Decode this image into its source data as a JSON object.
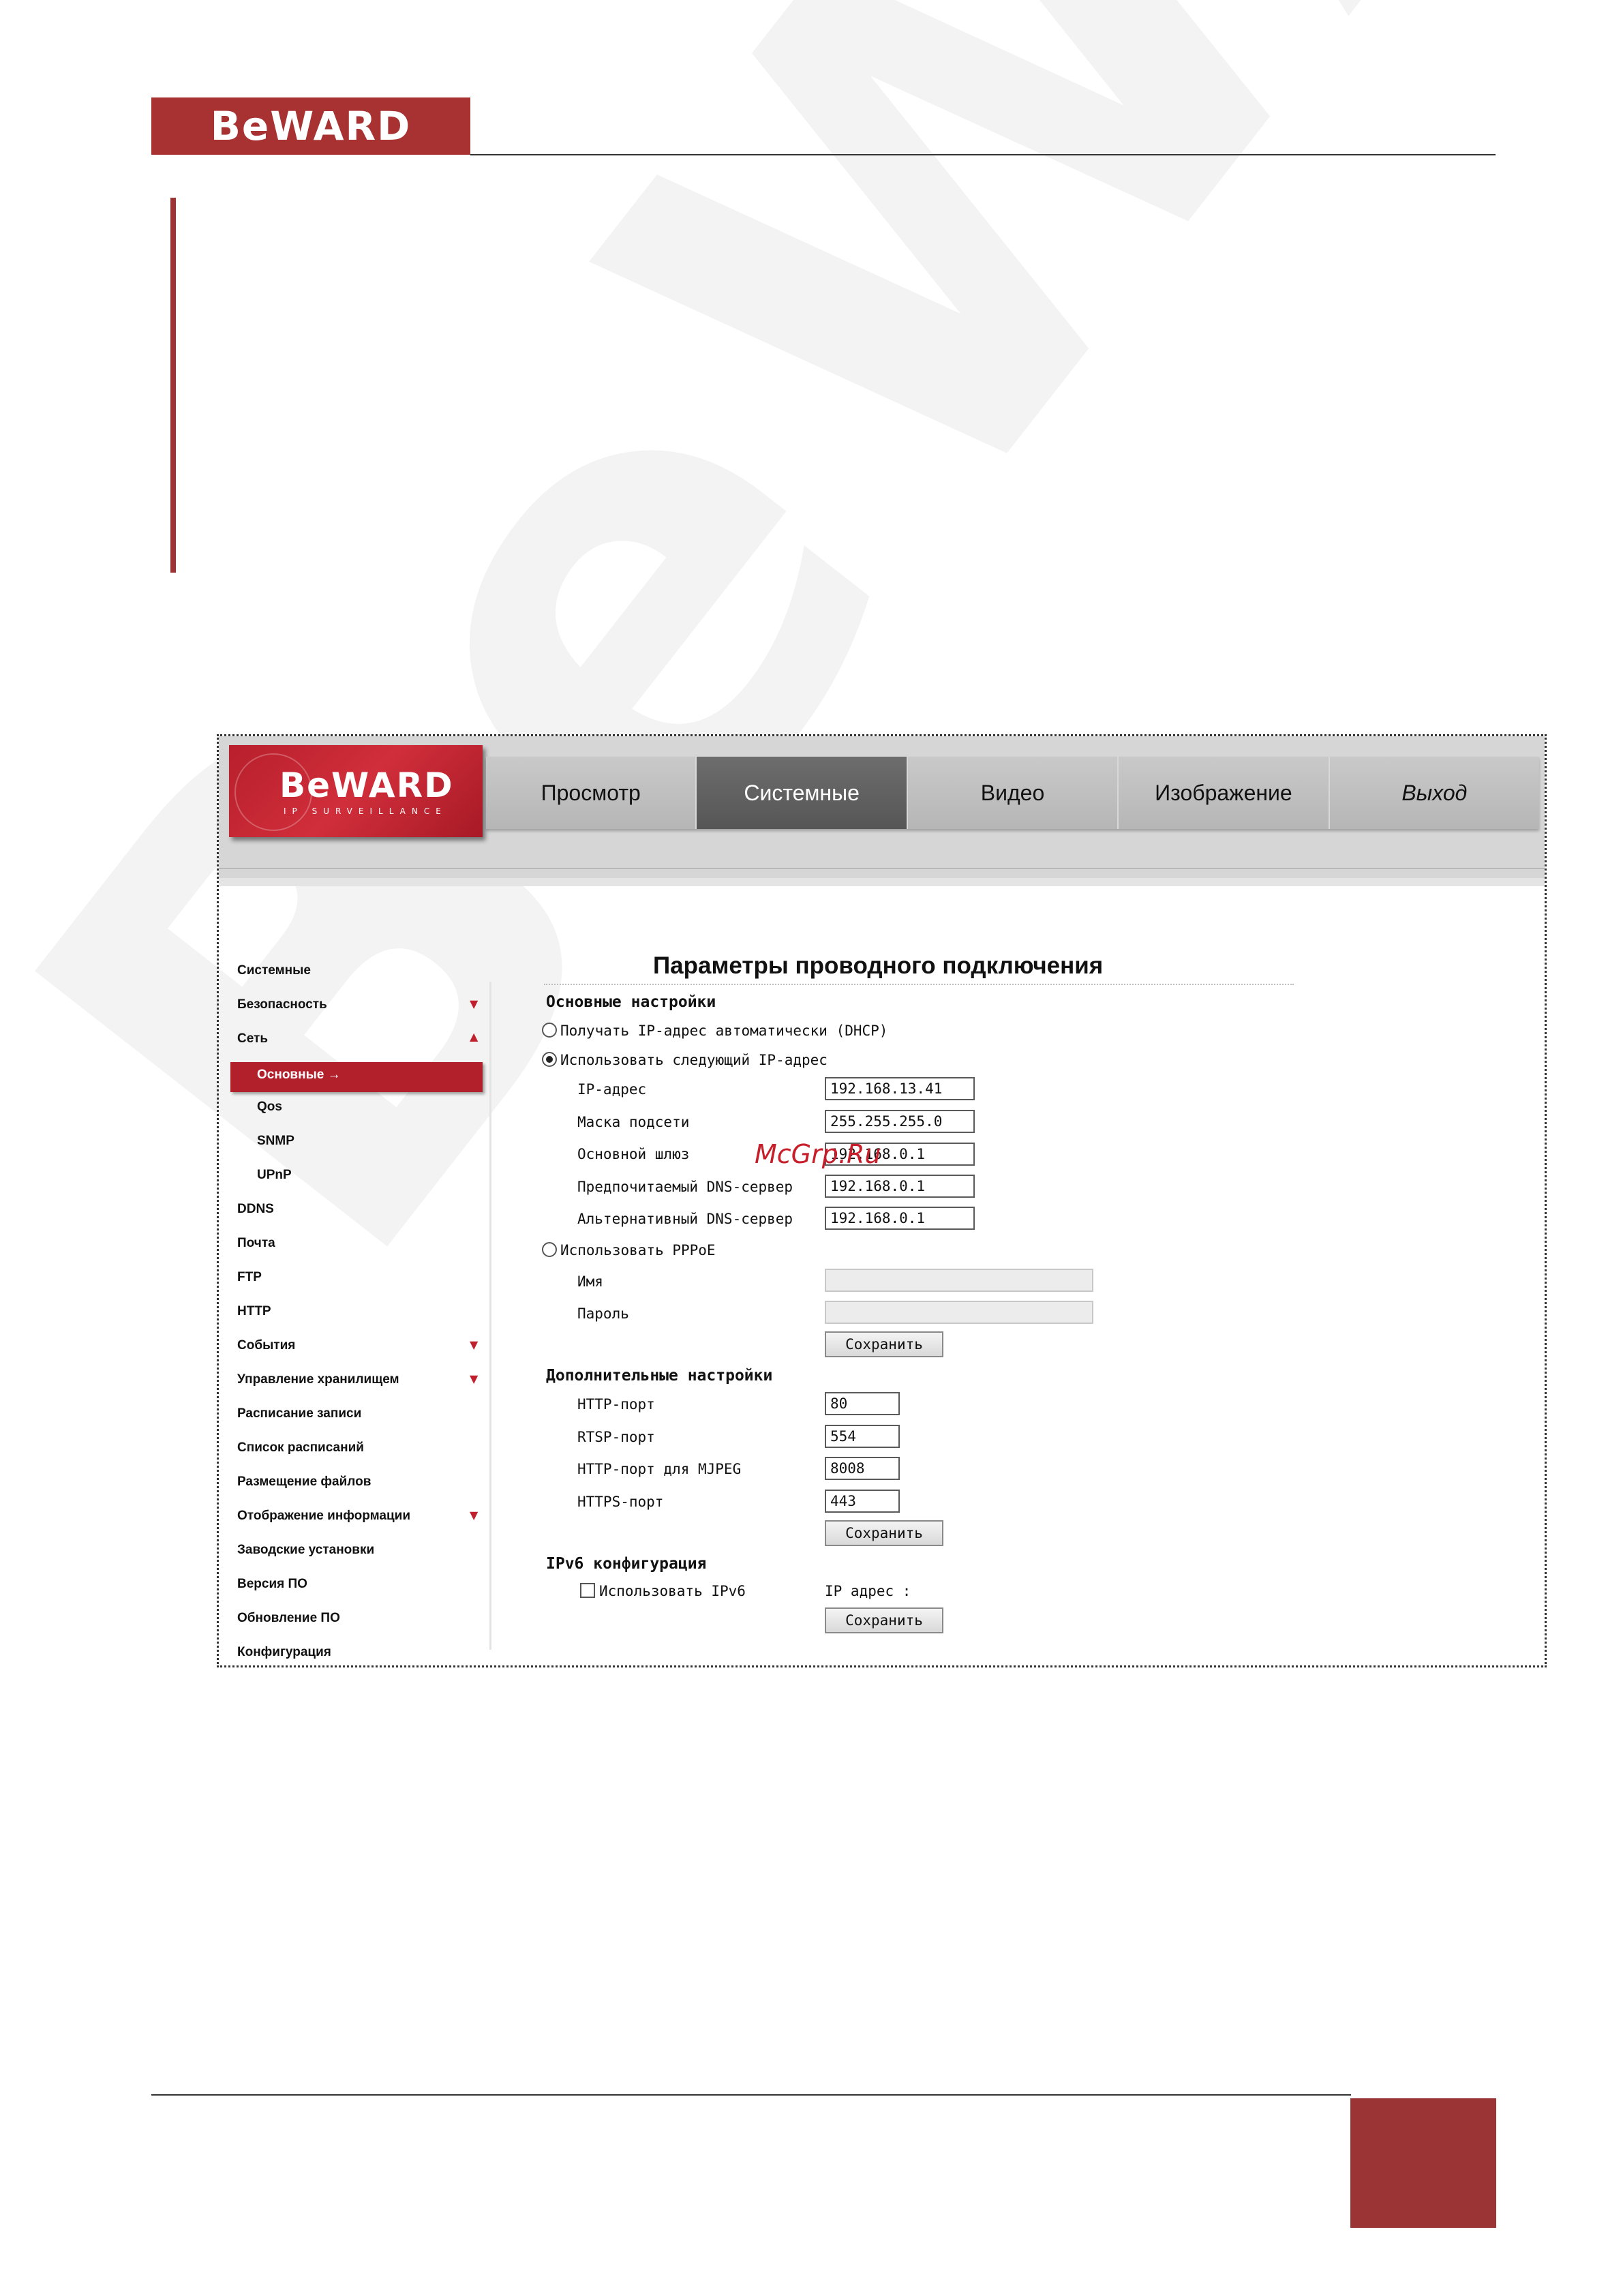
{
  "document": {
    "logo": "BeWARD"
  },
  "camera_ui": {
    "logo": "BeWARD",
    "logo_subtitle": "IP SURVEILLANCE",
    "nav": [
      {
        "label": "Просмотр"
      },
      {
        "label": "Системные"
      },
      {
        "label": "Видео"
      },
      {
        "label": "Изображение"
      },
      {
        "label": "Выход"
      }
    ],
    "sidebar": [
      {
        "label": "Системные"
      },
      {
        "label": "Безопасность"
      },
      {
        "label": "Сеть"
      },
      {
        "label": "Основные"
      },
      {
        "label": "Qos"
      },
      {
        "label": "SNMP"
      },
      {
        "label": "UPnP"
      },
      {
        "label": "DDNS"
      },
      {
        "label": "Почта"
      },
      {
        "label": "FTP"
      },
      {
        "label": "HTTP"
      },
      {
        "label": "События"
      },
      {
        "label": "Управление хранилищем"
      },
      {
        "label": "Расписание записи"
      },
      {
        "label": "Список расписаний"
      },
      {
        "label": "Размещение файлов"
      },
      {
        "label": "Отображение информации"
      },
      {
        "label": "Заводские установки"
      },
      {
        "label": "Версия ПО"
      },
      {
        "label": "Обновление ПО"
      },
      {
        "label": "Конфигурация"
      }
    ],
    "page_title": "Параметры проводного подключения",
    "basic": {
      "heading": "Основные настройки",
      "dhcp_label": "Получать IP-адрес автоматически (DHCP)",
      "static_label": "Использовать следующий IP-адрес",
      "ip_label": "IP-адрес",
      "ip_value": "192.168.13.41",
      "mask_label": "Маска подсети",
      "mask_value": "255.255.255.0",
      "gateway_label": "Основной шлюз",
      "gateway_value": "192.168.0.1",
      "dns1_label": "Предпочитаемый DNS-сервер",
      "dns1_value": "192.168.0.1",
      "dns2_label": "Альтернативный DNS-сервер",
      "dns2_value": "192.168.0.1",
      "pppoe_label": "Использовать PPPoE",
      "name_label": "Имя",
      "password_label": "Пароль",
      "save": "Сохранить"
    },
    "extra": {
      "heading": "Дополнительные настройки",
      "http_label": "HTTP-порт",
      "http_value": "80",
      "rtsp_label": "RTSP-порт",
      "rtsp_value": "554",
      "mjpeg_label": "HTTP-порт для MJPEG",
      "mjpeg_value": "8008",
      "https_label": "HTTPS-порт",
      "https_value": "443",
      "save": "Сохранить"
    },
    "ipv6": {
      "heading": "IPv6 конфигурация",
      "use_label": "Использовать IPv6",
      "address_label": "IP адрес :",
      "save": "Сохранить"
    },
    "overlay_watermark": "McGrp.Ru"
  }
}
